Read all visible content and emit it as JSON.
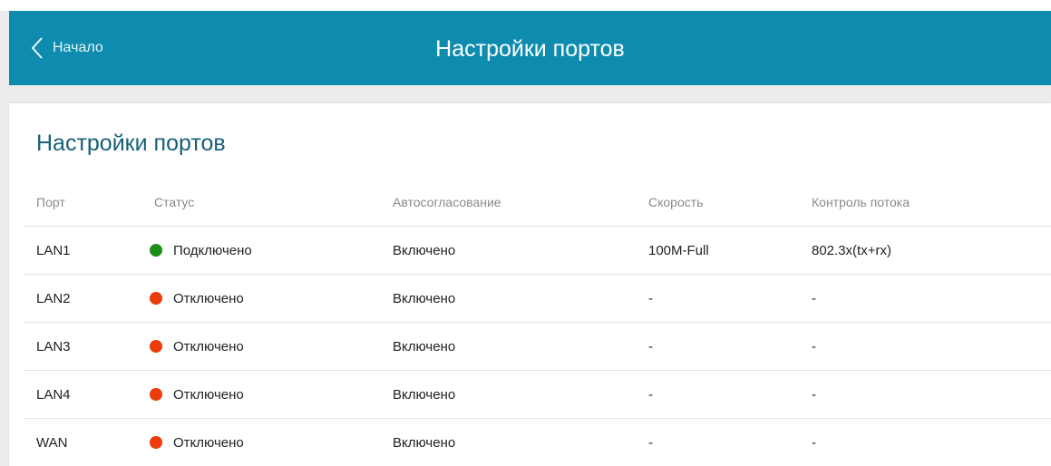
{
  "header": {
    "back_label": "Начало",
    "title": "Настройки портов"
  },
  "card": {
    "title": "Настройки портов"
  },
  "table": {
    "columns": [
      "Порт",
      "Статус",
      "Автосогласование",
      "Скорость",
      "Контроль потока"
    ],
    "rows": [
      {
        "port": "LAN1",
        "status": "Подключено",
        "status_state": "connected",
        "autoneg": "Включено",
        "speed": "100M-Full",
        "flow": "802.3x(tx+rx)"
      },
      {
        "port": "LAN2",
        "status": "Отключено",
        "status_state": "disconnected",
        "autoneg": "Включено",
        "speed": "-",
        "flow": "-"
      },
      {
        "port": "LAN3",
        "status": "Отключено",
        "status_state": "disconnected",
        "autoneg": "Включено",
        "speed": "-",
        "flow": "-"
      },
      {
        "port": "LAN4",
        "status": "Отключено",
        "status_state": "disconnected",
        "autoneg": "Включено",
        "speed": "-",
        "flow": "-"
      },
      {
        "port": "WAN",
        "status": "Отключено",
        "status_state": "disconnected",
        "autoneg": "Включено",
        "speed": "-",
        "flow": "-"
      }
    ]
  },
  "colors": {
    "header_bg": "#0d8caf",
    "card_title": "#17607a",
    "status_connected": "#1a8f1a",
    "status_disconnected": "#ec3b0b"
  },
  "icons": {
    "back": "chevron-left-icon",
    "status": "status-dot-icon"
  }
}
